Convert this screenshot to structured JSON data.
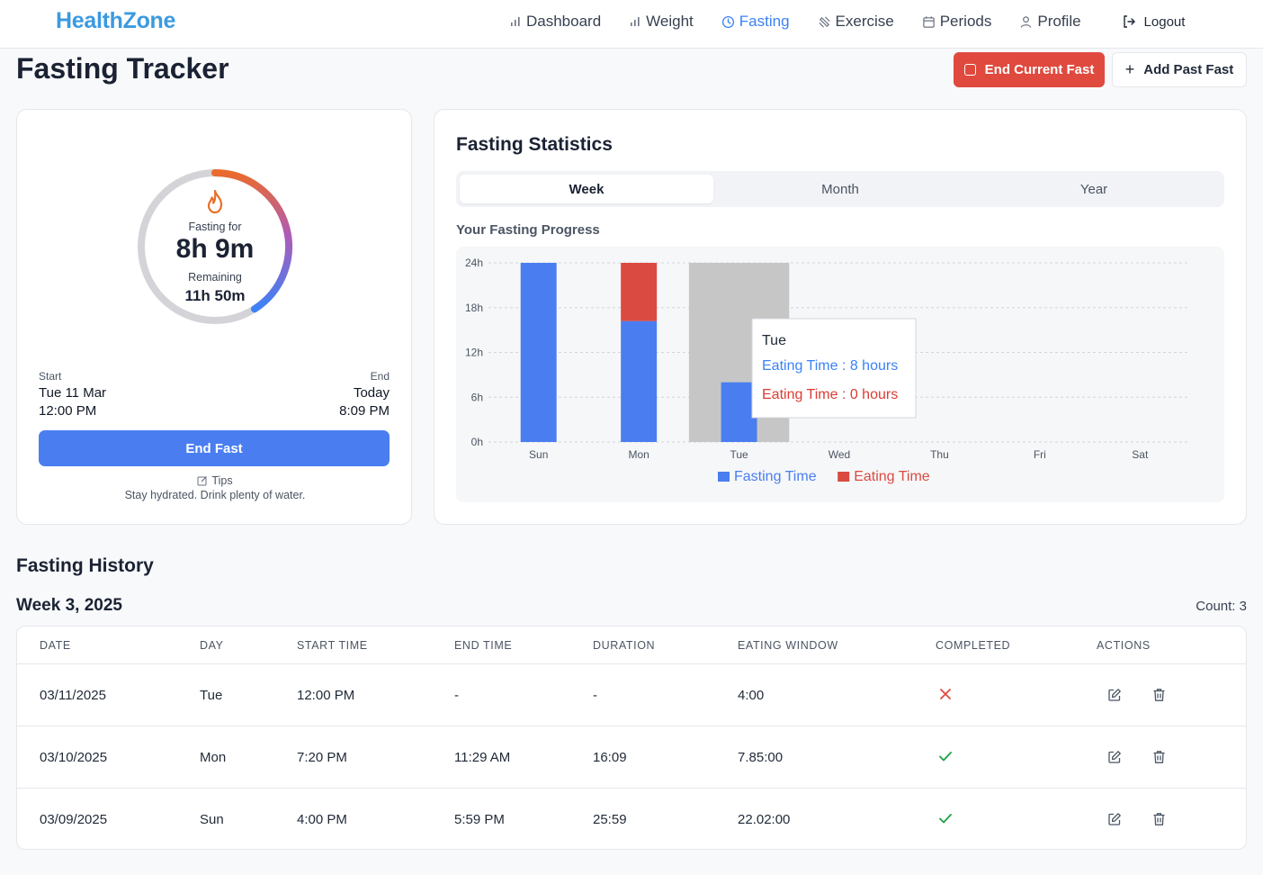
{
  "brand": "HealthZone",
  "nav": {
    "items": [
      {
        "label": "Dashboard",
        "icon": "bar-chart-icon",
        "active": false
      },
      {
        "label": "Weight",
        "icon": "bar-chart-icon",
        "active": false
      },
      {
        "label": "Fasting",
        "icon": "clock-icon",
        "active": true
      },
      {
        "label": "Exercise",
        "icon": "dumbbell-icon",
        "active": false
      },
      {
        "label": "Periods",
        "icon": "calendar-icon",
        "active": false
      },
      {
        "label": "Profile",
        "icon": "user-icon",
        "active": false
      }
    ],
    "logout": "Logout"
  },
  "page": {
    "title": "Fasting Tracker",
    "end_current_fast": "End Current Fast",
    "add_past_fast": "Add Past Fast"
  },
  "timer": {
    "fasting_for_label": "Fasting for",
    "elapsed": "8h 9m",
    "remaining_label": "Remaining",
    "remaining": "11h 50m",
    "progress_fraction": 0.41,
    "start_label": "Start",
    "start_date": "Tue 11 Mar",
    "start_time": "12:00 PM",
    "end_label": "End",
    "end_date": "Today",
    "end_time": "8:09 PM",
    "end_fast_button": "End Fast",
    "tips_label": "Tips",
    "tip_text": "Stay hydrated. Drink plenty of water."
  },
  "stats": {
    "title": "Fasting Statistics",
    "tabs": [
      "Week",
      "Month",
      "Year"
    ],
    "active_tab": "Week",
    "progress_label": "Your Fasting Progress"
  },
  "chart_data": {
    "type": "bar",
    "stacked": true,
    "categories": [
      "Sun",
      "Mon",
      "Tue",
      "Wed",
      "Thu",
      "Fri",
      "Sat"
    ],
    "series": [
      {
        "name": "Fasting Time",
        "color": "#4a7ef0",
        "values": [
          24,
          16.2,
          8,
          0,
          0,
          0,
          0
        ]
      },
      {
        "name": "Eating Time",
        "color": "#db4a40",
        "values": [
          0,
          7.8,
          0,
          0,
          0,
          0,
          0
        ]
      }
    ],
    "y_ticks": [
      "0h",
      "6h",
      "12h",
      "18h",
      "24h"
    ],
    "ylim": [
      0,
      24
    ],
    "grid": true,
    "legend_position": "bottom",
    "hover_category": "Tue",
    "tooltip": {
      "title": "Tue",
      "lines": [
        {
          "text": "Eating Time : 8 hours",
          "color": "#3b82f6"
        },
        {
          "text": "Eating Time : 0 hours",
          "color": "#dc3c33"
        }
      ]
    }
  },
  "history": {
    "title": "Fasting History",
    "week_label": "Week 3, 2025",
    "count_label": "Count: 3",
    "columns": [
      "DATE",
      "DAY",
      "START TIME",
      "END TIME",
      "DURATION",
      "EATING WINDOW",
      "COMPLETED",
      "ACTIONS"
    ],
    "rows": [
      {
        "date": "03/11/2025",
        "day": "Tue",
        "start": "12:00 PM",
        "end": "-",
        "duration": "-",
        "eating_window": "4:00",
        "completed": false
      },
      {
        "date": "03/10/2025",
        "day": "Mon",
        "start": "7:20 PM",
        "end": "11:29 AM",
        "duration": "16:09",
        "eating_window": "7.85:00",
        "completed": true
      },
      {
        "date": "03/09/2025",
        "day": "Sun",
        "start": "4:00 PM",
        "end": "5:59 PM",
        "duration": "25:59",
        "eating_window": "22.02:00",
        "completed": true
      }
    ]
  }
}
